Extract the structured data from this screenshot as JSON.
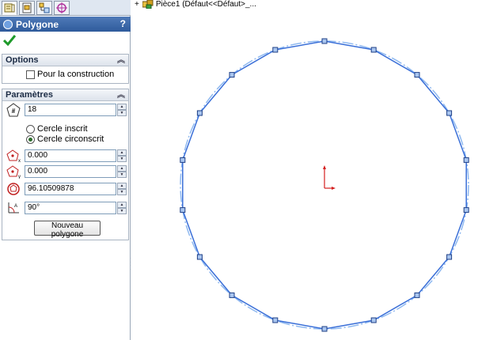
{
  "panel": {
    "title": "Polygone",
    "help": "?",
    "tabs": [
      "property-manager-icon",
      "configuration-icon",
      "feature-tree-icon",
      "display-manager-icon"
    ]
  },
  "options": {
    "title": "Options",
    "construction_label": "Pour la construction",
    "construction_checked": false
  },
  "params": {
    "title": "Paramètres",
    "sides": "18",
    "radio_inscribed": "Cercle inscrit",
    "radio_circumscribed": "Cercle circonscrit",
    "selected": "circumscribed",
    "center_x": "0.000",
    "center_y": "0.000",
    "diameter": "96.10509878",
    "angle": "90°",
    "new_button": "Nouveau polygone"
  },
  "tree": {
    "root_label": "Pièce1  (Défaut<<Défaut>_..."
  },
  "colors": {
    "polygon": "#3a6fd8",
    "circle": "#8fb9f0",
    "vertex": "#1e3f86",
    "origin": "#d42020"
  },
  "polygon": {
    "sides": 18,
    "start_angle_deg": 90
  }
}
